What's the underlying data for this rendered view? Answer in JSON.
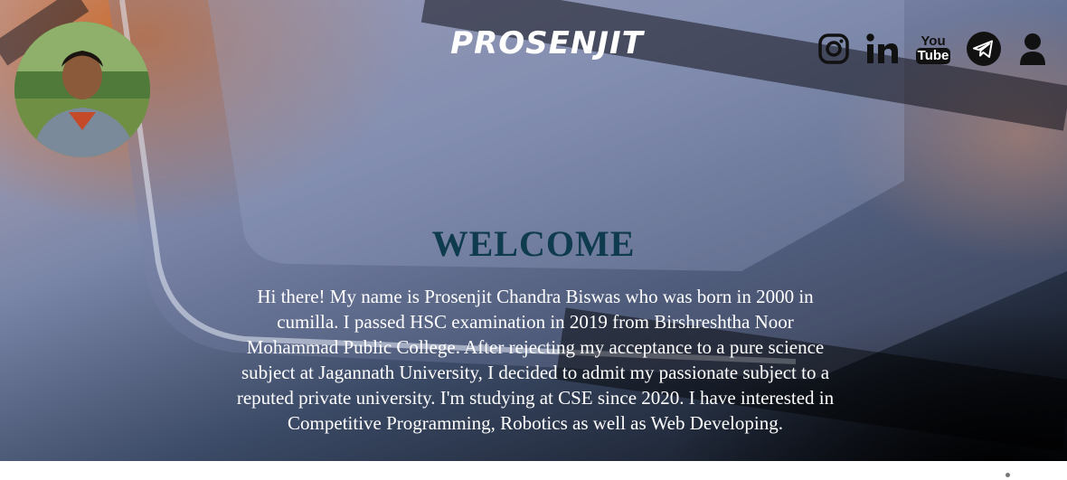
{
  "header": {
    "brand": "PROSENJIT",
    "social": [
      {
        "name": "instagram-icon"
      },
      {
        "name": "linkedin-icon"
      },
      {
        "name": "youtube-icon",
        "text_top": "You",
        "text_bottom": "Tube"
      },
      {
        "name": "telegram-icon"
      },
      {
        "name": "user-icon"
      }
    ]
  },
  "hero": {
    "heading": "WELCOME",
    "bio": "Hi there! My name is Prosenjit Chandra Biswas who was born in 2000 in cumilla. I passed HSC examination in 2019 from Birshreshtha Noor Mohammad Public College. After rejecting my acceptance to a pure science subject at Jagannath University, I decided to admit my passionate subject to a reputed private university. I'm studying at CSE since 2020. I have interested in Competitive Programming, Robotics as well as Web Developing."
  },
  "colors": {
    "heading": "#0f3b4e",
    "icon": "#111111",
    "text": "#ffffff"
  }
}
